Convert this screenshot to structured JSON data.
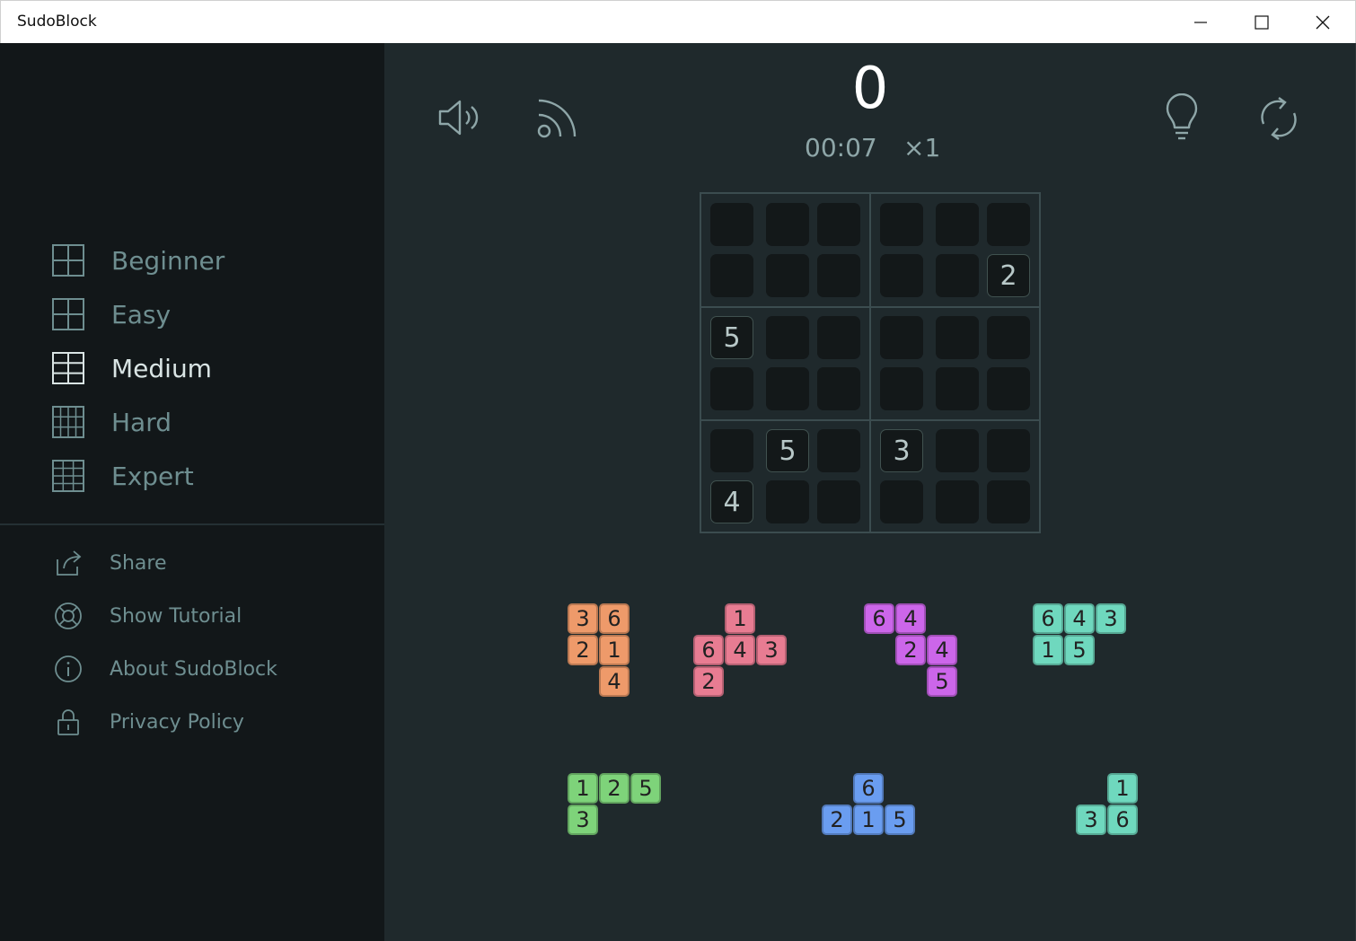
{
  "window": {
    "title": "SudoBlock"
  },
  "sidebar": {
    "difficulties": [
      {
        "label": "Beginner",
        "active": false
      },
      {
        "label": "Easy",
        "active": false
      },
      {
        "label": "Medium",
        "active": true
      },
      {
        "label": "Hard",
        "active": false
      },
      {
        "label": "Expert",
        "active": false
      }
    ],
    "menu": [
      {
        "label": "Share",
        "icon": "share-icon"
      },
      {
        "label": "Show Tutorial",
        "icon": "lifebuoy-icon"
      },
      {
        "label": "About SudoBlock",
        "icon": "info-icon"
      },
      {
        "label": "Privacy Policy",
        "icon": "lock-icon"
      }
    ]
  },
  "toolbar": {
    "sound_icon": "speaker-icon",
    "cast_icon": "cast-icon",
    "hint_icon": "lightbulb-icon",
    "restart_icon": "refresh-icon"
  },
  "status": {
    "score": "0",
    "timer": "00:07",
    "multiplier": "×1"
  },
  "board": {
    "rows": [
      [
        "",
        "",
        "",
        "",
        "",
        ""
      ],
      [
        "",
        "",
        "",
        "",
        "",
        "2"
      ],
      [
        "5",
        "",
        "",
        "",
        "",
        ""
      ],
      [
        "",
        "",
        "",
        "",
        "",
        ""
      ],
      [
        "",
        "5",
        "",
        "3",
        "",
        ""
      ],
      [
        "4",
        "",
        "",
        "",
        "",
        ""
      ]
    ]
  },
  "pieces": [
    {
      "color": "#ee9a6a",
      "cells": [
        [
          "3",
          "6"
        ],
        [
          "2",
          "1"
        ],
        [
          "",
          "4"
        ]
      ]
    },
    {
      "color": "#e87c92",
      "cells": [
        [
          "",
          "1",
          ""
        ],
        [
          "6",
          "4",
          "3"
        ],
        [
          "2",
          "",
          ""
        ]
      ]
    },
    {
      "color": "#cc66ea",
      "cells": [
        [
          "6",
          "4",
          ""
        ],
        [
          "",
          "2",
          "4"
        ],
        [
          "",
          "",
          "5"
        ]
      ]
    },
    {
      "color": "#6fd8be",
      "cells": [
        [
          "6",
          "4",
          "3"
        ],
        [
          "1",
          "5",
          ""
        ]
      ]
    },
    {
      "color": "#7ed37a",
      "cells": [
        [
          "1",
          "2",
          "5"
        ],
        [
          "3",
          "",
          ""
        ]
      ]
    },
    {
      "color": "#6a9df0",
      "cells": [
        [
          "",
          "6",
          ""
        ],
        [
          "2",
          "1",
          "5"
        ]
      ]
    },
    {
      "color": "#6fd8be",
      "cells": [
        [
          "",
          "1"
        ],
        [
          "3",
          "6"
        ]
      ]
    }
  ]
}
